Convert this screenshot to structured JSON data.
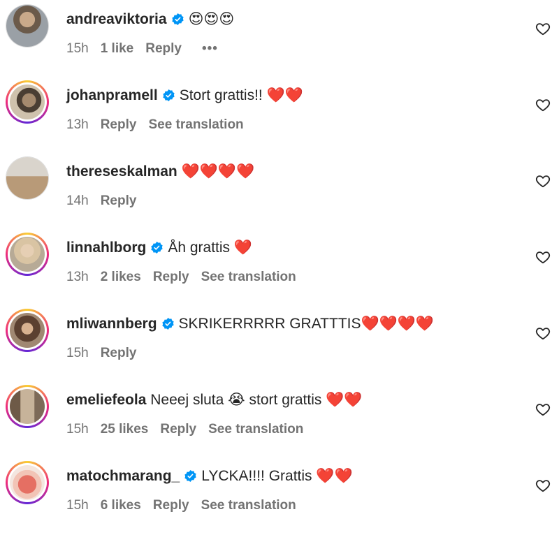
{
  "comments": [
    {
      "username": "andreaviktoria",
      "verified": true,
      "text": "😍😍😍",
      "time": "15h",
      "likes": "1 like",
      "reply": "Reply",
      "translation": "",
      "more": "•••",
      "avatar_color": "#8a8f96"
    },
    {
      "username": "johanpramell",
      "verified": true,
      "text": "Stort grattis!! ❤️❤️",
      "time": "13h",
      "likes": "",
      "reply": "Reply",
      "translation": "See translation",
      "avatar_color": "#7a6a55"
    },
    {
      "username": "thereseskalman",
      "verified": false,
      "text": "❤️❤️❤️❤️",
      "time": "14h",
      "likes": "",
      "reply": "Reply",
      "translation": "",
      "avatar_color": "#c9b49a"
    },
    {
      "username": "linnahlborg",
      "verified": true,
      "text": "Åh grattis ❤️",
      "time": "13h",
      "likes": "2 likes",
      "reply": "Reply",
      "translation": "See translation",
      "avatar_color": "#cdbfa8"
    },
    {
      "username": "mliwannberg",
      "verified": true,
      "text": "SKRIKERRRRR GRATTTIS❤️❤️❤️❤️",
      "time": "15h",
      "likes": "",
      "reply": "Reply",
      "translation": "",
      "avatar_color": "#8a6b52"
    },
    {
      "username": "emeliefeola",
      "verified": false,
      "text": "Neeej sluta 😭 stort grattis ❤️❤️",
      "time": "15h",
      "likes": "25 likes",
      "reply": "Reply",
      "translation": "See translation",
      "avatar_color": "#9a8670"
    },
    {
      "username": "matochmarang_",
      "verified": true,
      "text": "LYCKA!!!! Grattis ❤️❤️",
      "time": "15h",
      "likes": "6 likes",
      "reply": "Reply",
      "translation": "See translation",
      "avatar_color": "#e39a8e"
    }
  ],
  "colors": {
    "verified": "#0095f6",
    "secondary_text": "#737373",
    "primary_text": "#262626"
  }
}
